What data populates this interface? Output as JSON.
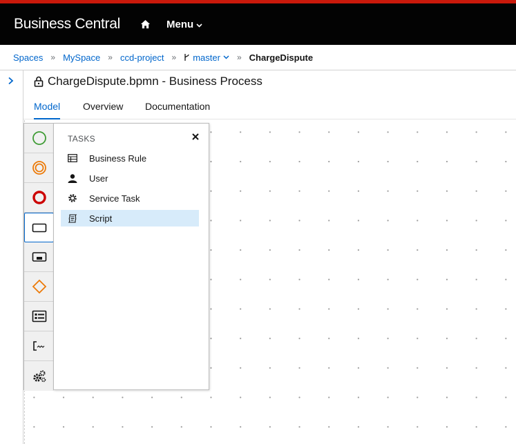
{
  "header": {
    "brand": "Business Central",
    "menu_label": "Menu"
  },
  "breadcrumb": {
    "spaces": "Spaces",
    "space": "MySpace",
    "project": "ccd-project",
    "branch": "master",
    "current": "ChargeDispute"
  },
  "document": {
    "title": "ChargeDispute.bpmn - Business Process"
  },
  "tabs": [
    {
      "label": "Model",
      "active": true
    },
    {
      "label": "Overview"
    },
    {
      "label": "Documentation"
    }
  ],
  "palette": {
    "items": [
      {
        "icon": "start-event-icon"
      },
      {
        "icon": "intermediate-event-icon"
      },
      {
        "icon": "end-event-icon"
      },
      {
        "icon": "task-icon",
        "selected": true
      },
      {
        "icon": "subprocess-icon"
      },
      {
        "icon": "gateway-icon"
      },
      {
        "icon": "lane-icon"
      },
      {
        "icon": "artifacts-icon"
      },
      {
        "icon": "service-tasks-icon"
      }
    ]
  },
  "flyout": {
    "header": "TASKS",
    "items": [
      {
        "label": "Business Rule",
        "icon": "table-icon"
      },
      {
        "label": "User",
        "icon": "user-icon"
      },
      {
        "label": "Service Task",
        "icon": "gear-icon"
      },
      {
        "label": "Script",
        "icon": "script-icon",
        "highlighted": true
      }
    ]
  },
  "colors": {
    "accent": "#0066cc",
    "start": "#3f9c35",
    "intermediate": "#ec7a08",
    "end": "#cc0000",
    "topbar_stripe": "#c9190b"
  }
}
